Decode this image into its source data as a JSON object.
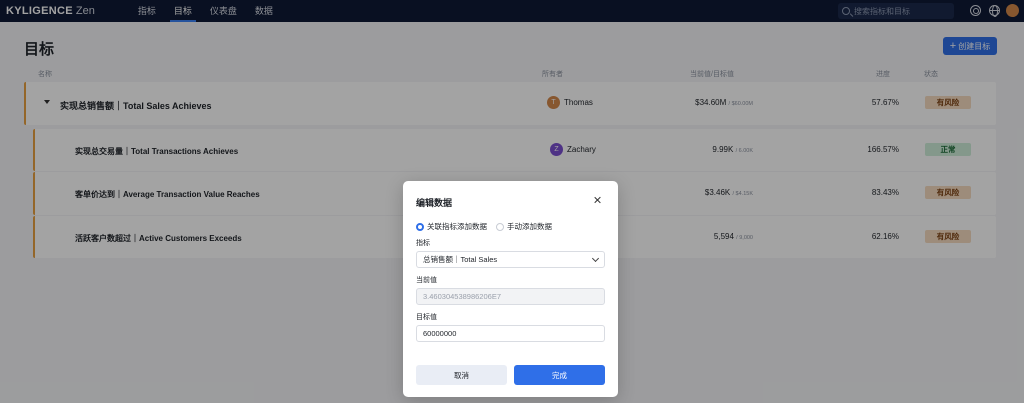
{
  "app": {
    "logo_main": "KYLIGENCE",
    "logo_sub": "Zen"
  },
  "nav": {
    "items": [
      "指标",
      "目标",
      "仪表盘",
      "数据"
    ],
    "active_index": 1
  },
  "search": {
    "placeholder": "搜索指标和目标"
  },
  "icons": {
    "search": "search-icon",
    "settings": "gear-icon",
    "language": "globe-icon",
    "caret": "caret-down-icon",
    "close": "close-icon",
    "plus": "plus-icon",
    "chevron": "chevron-down-icon"
  },
  "page": {
    "title": "目标",
    "create_button": "创建目标",
    "create_plus": "+"
  },
  "columns": {
    "name": "名称",
    "owner": "所有者",
    "value": "当前值/目标值",
    "progress": "进度",
    "status": "状态"
  },
  "goals": [
    {
      "name": "实现总销售额｜Total Sales Achieves",
      "owner": "Thomas",
      "owner_initial": "T",
      "owner_color": "#d4884a",
      "current": "$34.60M",
      "target": "/ $60.00M",
      "progress": "57.67%",
      "status": "有风险",
      "status_type": "risk"
    },
    {
      "name": "实现总交易量｜Total Transactions Achieves",
      "owner": "Zachary",
      "owner_initial": "Z",
      "owner_color": "#7b4fd1",
      "current": "9.99K",
      "target": "/ 6.00K",
      "progress": "166.57%",
      "status": "正常",
      "status_type": "normal"
    },
    {
      "name": "客单价达到｜Average Transaction Value Reaches",
      "owner": "",
      "owner_initial": "",
      "owner_color": "",
      "current": "$3.46K",
      "target": "/ $4.15K",
      "progress": "83.43%",
      "status": "有风险",
      "status_type": "risk"
    },
    {
      "name": "活跃客户数超过｜Active Customers Exceeds",
      "owner": "",
      "owner_initial": "",
      "owner_color": "",
      "current": "5,594",
      "target": "/ 9,000",
      "progress": "62.16%",
      "status": "有风险",
      "status_type": "risk"
    }
  ],
  "modal": {
    "title": "编辑数据",
    "radio_options": [
      "关联指标添加数据",
      "手动添加数据"
    ],
    "radio_selected": 0,
    "metric_label": "指标",
    "metric_value": "总销售额｜Total Sales",
    "current_label": "当前值",
    "current_value": "3.460304538986206E7",
    "target_label": "目标值",
    "target_value": "60000000",
    "cancel_label": "取消",
    "done_label": "完成"
  },
  "colors": {
    "nav_bg": "#0f1a36",
    "accent": "#2f6fe8",
    "risk_bg": "#f6dcc0",
    "normal_bg": "#cfeed9",
    "row_accent": "#e8a040"
  }
}
